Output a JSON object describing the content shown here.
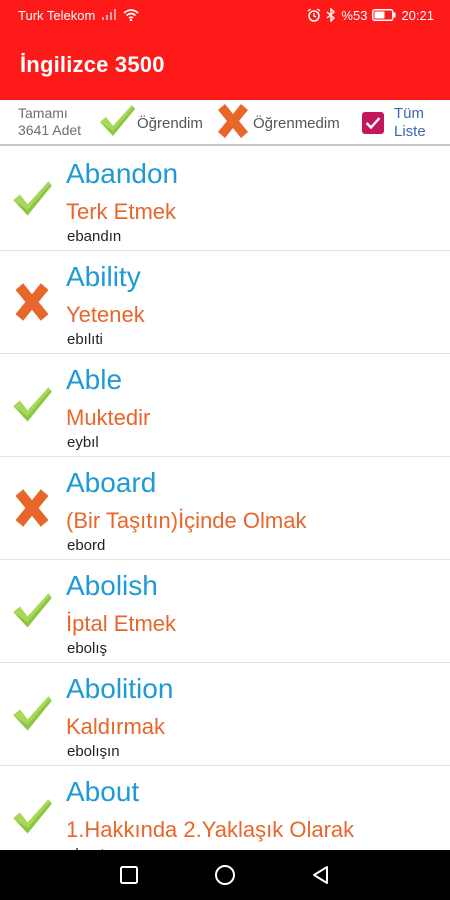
{
  "status_bar": {
    "carrier": "Turk Telekom",
    "battery": "%53",
    "time": "20:21"
  },
  "app_bar": {
    "title": "İngilizce 3500"
  },
  "filter_bar": {
    "total_line1": "Tamamı",
    "total_line2": "3641 Adet",
    "learned_label": "Öğrendim",
    "not_learned_label": "Öğrenmedim",
    "all_list_line1": "Tüm",
    "all_list_line2": "Liste",
    "all_list_checked": true
  },
  "words": [
    {
      "word": "Abandon",
      "meaning": "Terk Etmek",
      "pronunciation": "ebandın",
      "status": "learned"
    },
    {
      "word": "Ability",
      "meaning": "Yetenek",
      "pronunciation": "ebılıti",
      "status": "not_learned"
    },
    {
      "word": "Able",
      "meaning": "Muktedir",
      "pronunciation": "eybıl",
      "status": "learned"
    },
    {
      "word": "Aboard",
      "meaning": "(Bir Taşıtın)İçinde Olmak",
      "pronunciation": "ebord",
      "status": "not_learned"
    },
    {
      "word": "Abolish",
      "meaning": "İptal Etmek",
      "pronunciation": "ebolış",
      "status": "learned"
    },
    {
      "word": "Abolition",
      "meaning": "Kaldırmak",
      "pronunciation": "ebolışın",
      "status": "learned"
    },
    {
      "word": "About",
      "meaning": "1.Hakkında 2.Yaklaşık Olarak",
      "pronunciation": "ebaut",
      "status": "learned"
    }
  ],
  "colors": {
    "accent": "#ff1a1a",
    "word": "#1f9ad6",
    "meaning": "#e8662a",
    "check": "#8dc63f",
    "cross": "#e8662a",
    "checkbox": "#c2185b"
  },
  "icons": {
    "learned": "check-icon",
    "not_learned": "cross-icon"
  }
}
